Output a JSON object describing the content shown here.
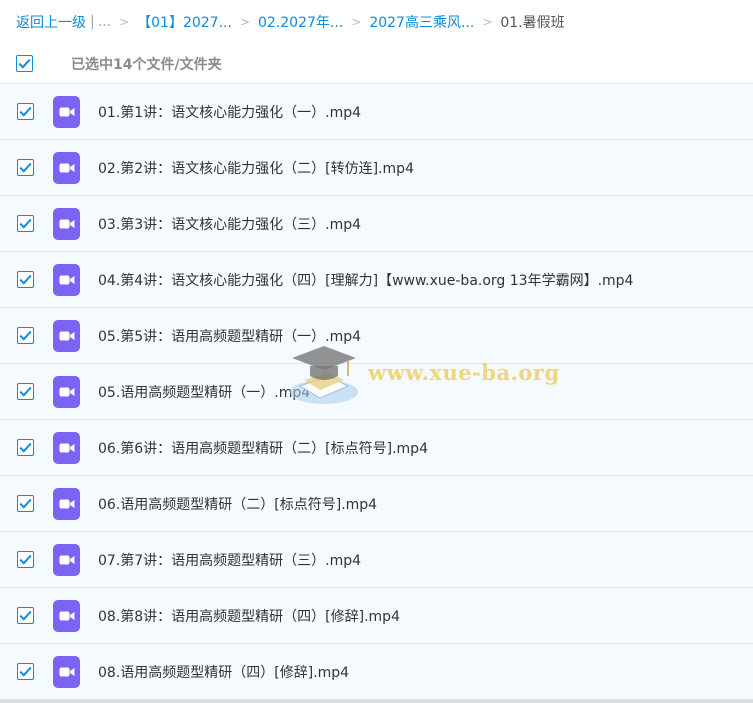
{
  "breadcrumb": {
    "back": "返回上一级",
    "separator": "|",
    "ellipsis": "...",
    "chevron": ">",
    "crumbs": [
      "【01】2027...",
      "02.2027年...",
      "2027高三乘风..."
    ],
    "current": "01.暑假班"
  },
  "selection": {
    "label": "已选中14个文件/文件夹",
    "all_checked": true
  },
  "accent_color": "#0d8bdc",
  "file_icon": {
    "name": "video-file-icon",
    "color": "#7b63f4"
  },
  "files": [
    {
      "name": "01.第1讲：语文核心能力强化（一）.mp4",
      "checked": true
    },
    {
      "name": "02.第2讲：语文核心能力强化（二）[转仿连].mp4",
      "checked": true
    },
    {
      "name": "03.第3讲：语文核心能力强化（三）.mp4",
      "checked": true
    },
    {
      "name": "04.第4讲：语文核心能力强化（四）[理解力]【www.xue-ba.org 13年学霸网】.mp4",
      "checked": true
    },
    {
      "name": "05.第5讲：语用高频题型精研（一）.mp4",
      "checked": true
    },
    {
      "name": "05.语用高频题型精研（一）.mp4",
      "checked": true
    },
    {
      "name": "06.第6讲：语用高频题型精研（二）[标点符号].mp4",
      "checked": true
    },
    {
      "name": "06.语用高频题型精研（二）[标点符号].mp4",
      "checked": true
    },
    {
      "name": "07.第7讲：语用高频题型精研（三）.mp4",
      "checked": true
    },
    {
      "name": "08.第8讲：语用高频题型精研（四）[修辞].mp4",
      "checked": true
    },
    {
      "name": "08.语用高频题型精研（四）[修辞].mp4",
      "checked": true
    }
  ],
  "watermark": {
    "text": "www.xue-ba.org"
  }
}
